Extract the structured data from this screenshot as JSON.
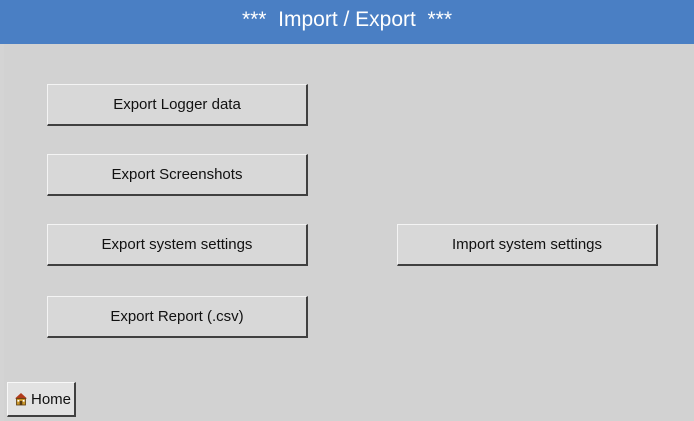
{
  "header": {
    "title": "***  Import / Export  ***"
  },
  "buttons": {
    "export_logger_data": "Export Logger data",
    "export_screenshots": "Export Screenshots",
    "export_system_settings": "Export system settings",
    "import_system_settings": "Import system settings",
    "export_report": "Export Report (.csv)"
  },
  "footer": {
    "home_label": "Home",
    "home_icon": "home-icon"
  },
  "colors": {
    "title_bar": "#4a7fc4",
    "background": "#d4d4d4"
  }
}
